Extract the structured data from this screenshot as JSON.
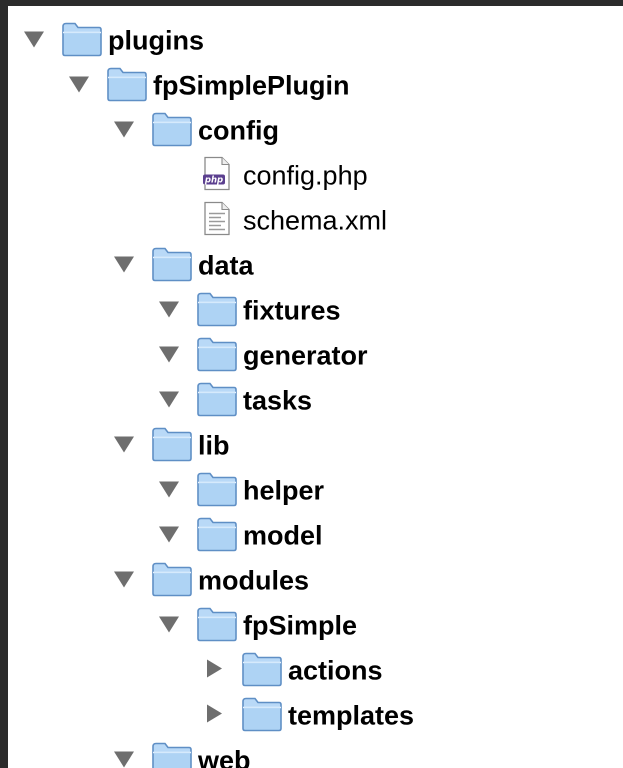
{
  "tree": [
    {
      "label": "plugins",
      "kind": "folder",
      "depth": 0,
      "expanded": true,
      "icon": "folder-icon"
    },
    {
      "label": "fpSimplePlugin",
      "kind": "folder",
      "depth": 1,
      "expanded": true,
      "icon": "folder-icon"
    },
    {
      "label": "config",
      "kind": "folder",
      "depth": 2,
      "expanded": true,
      "icon": "folder-icon"
    },
    {
      "label": "config.php",
      "kind": "file",
      "depth": 3,
      "icon": "php-file-icon"
    },
    {
      "label": "schema.xml",
      "kind": "file",
      "depth": 3,
      "icon": "text-file-icon"
    },
    {
      "label": "data",
      "kind": "folder",
      "depth": 2,
      "expanded": true,
      "icon": "folder-icon"
    },
    {
      "label": "fixtures",
      "kind": "folder",
      "depth": 3,
      "expanded": true,
      "icon": "folder-icon"
    },
    {
      "label": "generator",
      "kind": "folder",
      "depth": 3,
      "expanded": true,
      "icon": "folder-icon"
    },
    {
      "label": "tasks",
      "kind": "folder",
      "depth": 3,
      "expanded": true,
      "icon": "folder-icon"
    },
    {
      "label": "lib",
      "kind": "folder",
      "depth": 2,
      "expanded": true,
      "icon": "folder-icon"
    },
    {
      "label": "helper",
      "kind": "folder",
      "depth": 3,
      "expanded": true,
      "icon": "folder-icon"
    },
    {
      "label": "model",
      "kind": "folder",
      "depth": 3,
      "expanded": true,
      "icon": "folder-icon"
    },
    {
      "label": "modules",
      "kind": "folder",
      "depth": 2,
      "expanded": true,
      "icon": "folder-icon"
    },
    {
      "label": "fpSimple",
      "kind": "folder",
      "depth": 3,
      "expanded": true,
      "icon": "folder-icon"
    },
    {
      "label": "actions",
      "kind": "folder",
      "depth": 4,
      "expanded": false,
      "icon": "folder-icon"
    },
    {
      "label": "templates",
      "kind": "folder",
      "depth": 4,
      "expanded": false,
      "icon": "folder-icon"
    },
    {
      "label": "web",
      "kind": "folder",
      "depth": 2,
      "expanded": true,
      "icon": "folder-icon"
    }
  ],
  "colors": {
    "folder_fill": "#b9d9f7",
    "folder_stroke": "#5f8fc5",
    "disclosure": "#6e6e6e",
    "php_badge": "#5b3f8f"
  }
}
